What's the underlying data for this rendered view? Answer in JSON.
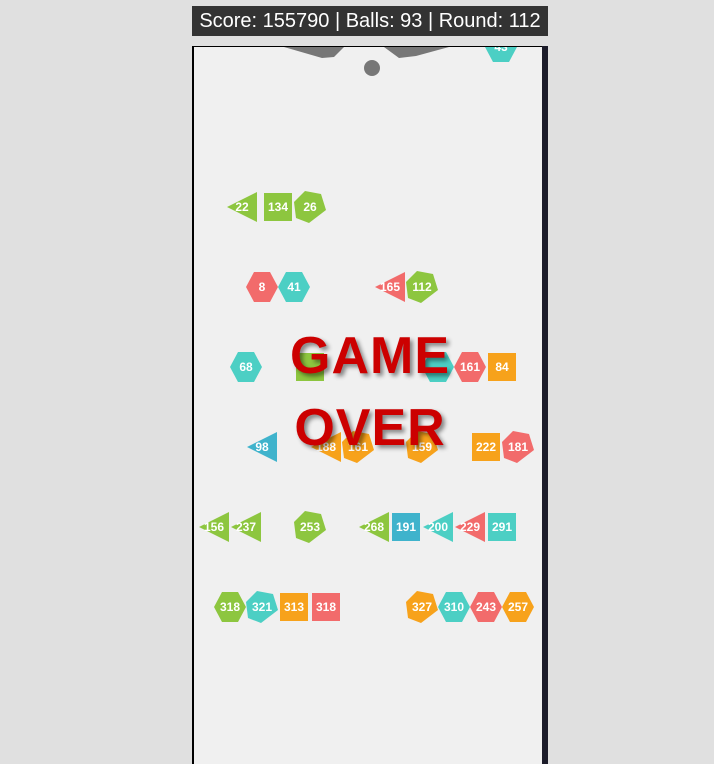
{
  "hud": {
    "score_text": "Score: 155790 | Balls: 93 | Round: 112"
  },
  "game_over": {
    "line1": "GAME",
    "line2": "OVER"
  },
  "colors": {
    "green": "#8dc63f",
    "red": "#f26b6b",
    "teal": "#4ccfc4",
    "orange": "#f7a21b",
    "blue": "#3fb3cc",
    "launcher": "#777777"
  },
  "rows": [
    {
      "blocks": [
        {
          "shape": "hexagon",
          "color": "teal",
          "value": "43"
        }
      ]
    },
    {
      "blocks": [
        {
          "shape": "triangle-left",
          "color": "green",
          "value": "22"
        },
        {
          "shape": "square",
          "color": "green",
          "value": "134"
        },
        {
          "shape": "pentagon",
          "color": "green",
          "value": "26"
        }
      ]
    },
    {
      "blocks": [
        {
          "shape": "hexagon",
          "color": "red",
          "value": "8"
        },
        {
          "shape": "hexagon",
          "color": "teal",
          "value": "41"
        },
        {
          "shape": "triangle-left",
          "color": "red",
          "value": "165"
        },
        {
          "shape": "pentagon",
          "color": "green",
          "value": "112"
        }
      ]
    },
    {
      "blocks": [
        {
          "shape": "hexagon",
          "color": "teal",
          "value": "68"
        },
        {
          "shape": "square",
          "color": "green",
          "value": ""
        },
        {
          "shape": "hexagon",
          "color": "teal",
          "value": ""
        },
        {
          "shape": "hexagon",
          "color": "red",
          "value": "161"
        },
        {
          "shape": "square",
          "color": "orange",
          "value": "84"
        }
      ]
    },
    {
      "blocks": [
        {
          "shape": "triangle-left",
          "color": "blue",
          "value": "98"
        },
        {
          "shape": "triangle-left",
          "color": "orange",
          "value": "188"
        },
        {
          "shape": "pentagon",
          "color": "orange",
          "value": "161"
        },
        {
          "shape": "pentagon",
          "color": "orange",
          "value": "159"
        },
        {
          "shape": "square",
          "color": "orange",
          "value": "222"
        },
        {
          "shape": "pentagon",
          "color": "red",
          "value": "181"
        }
      ]
    },
    {
      "blocks": [
        {
          "shape": "triangle-left",
          "color": "green",
          "value": "156"
        },
        {
          "shape": "triangle-left",
          "color": "green",
          "value": "237"
        },
        {
          "shape": "pentagon",
          "color": "green",
          "value": "253"
        },
        {
          "shape": "triangle-left",
          "color": "green",
          "value": "268"
        },
        {
          "shape": "square",
          "color": "blue",
          "value": "191"
        },
        {
          "shape": "triangle-left",
          "color": "teal",
          "value": "200"
        },
        {
          "shape": "triangle-left",
          "color": "red",
          "value": "229"
        },
        {
          "shape": "square",
          "color": "teal",
          "value": "291"
        }
      ]
    },
    {
      "blocks": [
        {
          "shape": "hexagon",
          "color": "green",
          "value": "318"
        },
        {
          "shape": "pentagon",
          "color": "teal",
          "value": "321"
        },
        {
          "shape": "square",
          "color": "orange",
          "value": "313"
        },
        {
          "shape": "square",
          "color": "red",
          "value": "318"
        },
        {
          "shape": "pentagon",
          "color": "orange",
          "value": "327"
        },
        {
          "shape": "hexagon",
          "color": "teal",
          "value": "310"
        },
        {
          "shape": "hexagon",
          "color": "red",
          "value": "243"
        },
        {
          "shape": "hexagon",
          "color": "orange",
          "value": "257"
        }
      ]
    }
  ]
}
